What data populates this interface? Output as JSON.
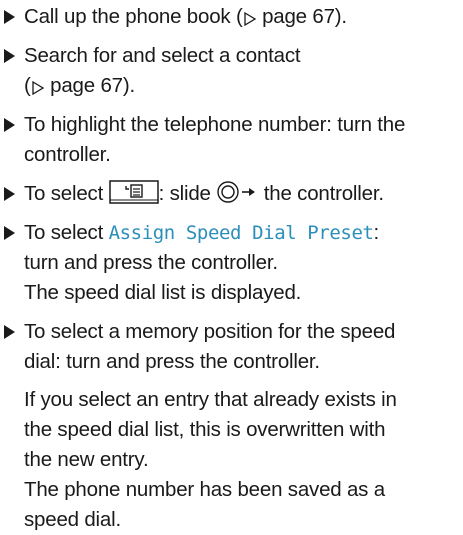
{
  "steps": [
    {
      "parts": [
        "Call up the phone book (",
        "page 67)."
      ]
    },
    {
      "line1": "Search for and select a contact",
      "line2_parts": [
        "(",
        "page 67)."
      ]
    },
    {
      "line1": "To highlight the telephone number: turn the",
      "line2": "controller."
    },
    {
      "parts": [
        "To select ",
        ": slide ",
        " the controller."
      ]
    },
    {
      "line1_prefix": "To select ",
      "menu_item": "Assign Speed Dial Preset",
      "line1_suffix": ":",
      "line2": "turn and press the controller.",
      "line3": "The speed dial list is displayed."
    },
    {
      "line1": "To select a memory position for the speed",
      "line2": "dial: turn and press the controller.",
      "para1_line1": "If you select an entry that already exists in",
      "para1_line2": "the speed dial list, this is overwritten with",
      "para1_line3": "the new entry.",
      "para2_line1": "The phone number has been saved as a",
      "para2_line2": "speed dial."
    }
  ],
  "icons": {
    "bullet": "triangle-bullet-icon",
    "page_ref": "page-reference-arrow-icon",
    "phonebook_key": "phonebook-options-icon",
    "controller_slide": "controller-slide-right-icon"
  },
  "colors": {
    "text": "#1a1a1a",
    "menu_item": "#2c8fba"
  }
}
